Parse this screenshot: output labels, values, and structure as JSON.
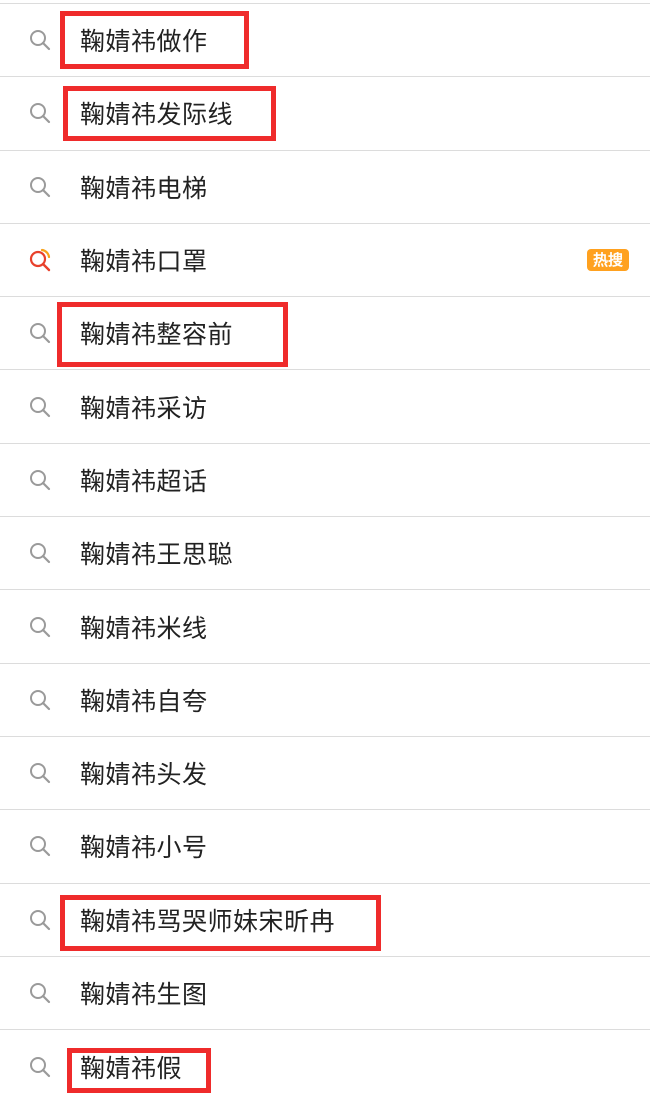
{
  "search_suggestions": {
    "items": [
      {
        "label": "鞠婧祎做作",
        "icon": "search-icon"
      },
      {
        "label": "鞠婧祎发际线",
        "icon": "search-icon"
      },
      {
        "label": "鞠婧祎电梯",
        "icon": "search-icon"
      },
      {
        "label": "鞠婧祎口罩",
        "icon": "hot-search-icon",
        "badge": "热搜"
      },
      {
        "label": "鞠婧祎整容前",
        "icon": "search-icon"
      },
      {
        "label": "鞠婧祎采访",
        "icon": "search-icon"
      },
      {
        "label": "鞠婧祎超话",
        "icon": "search-icon"
      },
      {
        "label": "鞠婧祎王思聪",
        "icon": "search-icon"
      },
      {
        "label": "鞠婧祎米线",
        "icon": "search-icon"
      },
      {
        "label": "鞠婧祎自夸",
        "icon": "search-icon"
      },
      {
        "label": "鞠婧祎头发",
        "icon": "search-icon"
      },
      {
        "label": "鞠婧祎小号",
        "icon": "search-icon"
      },
      {
        "label": "鞠婧祎骂哭师妹宋昕冉",
        "icon": "search-icon"
      },
      {
        "label": "鞠婧祎生图",
        "icon": "search-icon"
      },
      {
        "label": "鞠婧祎假",
        "icon": "search-icon"
      }
    ]
  },
  "colors": {
    "highlight_box": "#ef2b2b",
    "hot_badge": "#ffa11f",
    "divider": "#dcdcdc",
    "text": "#222222",
    "search_icon": "#9a9a9a"
  }
}
